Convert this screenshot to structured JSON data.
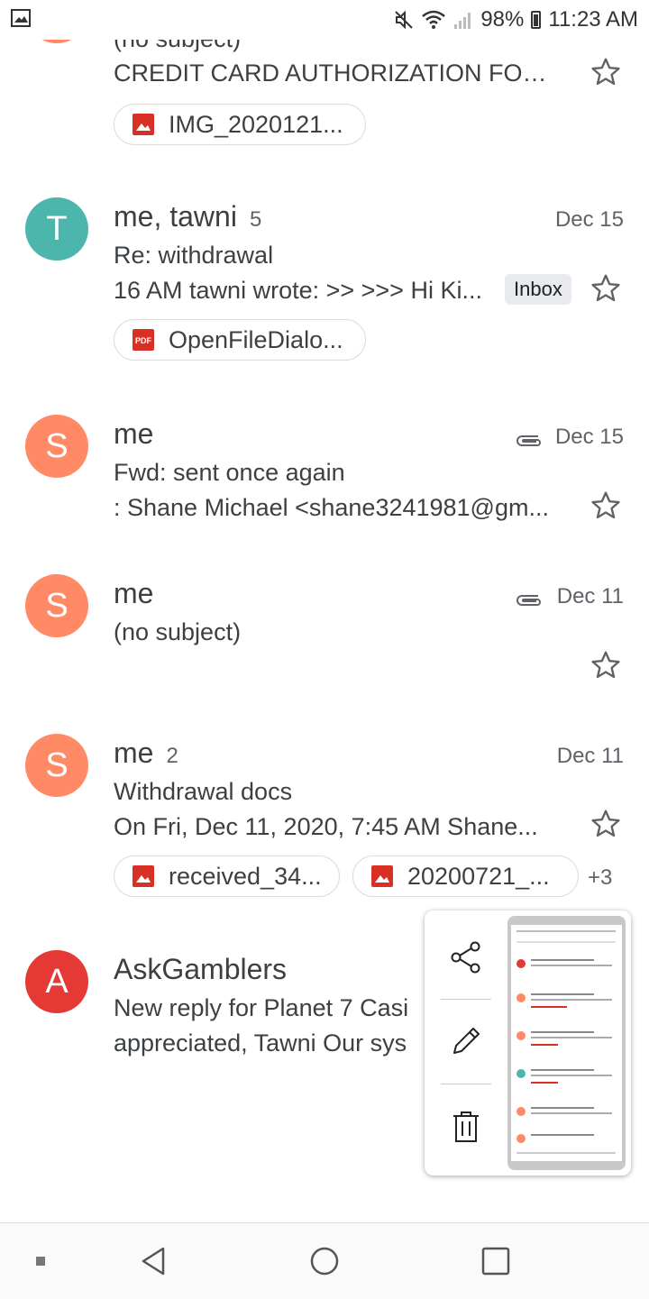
{
  "status_bar": {
    "battery": "98%",
    "time": "11:23 AM"
  },
  "emails": [
    {
      "id": "e0",
      "sender": "",
      "subject": "(no subject)",
      "snippet": "CREDIT CARD AUTHORIZATION FOR...",
      "attachments": [
        "IMG_2020121..."
      ],
      "avatar_color": "#ff8a65"
    },
    {
      "id": "e1",
      "avatar_letter": "T",
      "avatar_color": "#4db6ac",
      "sender": "me, tawni",
      "count": "5",
      "date": "Dec 15",
      "subject": "Re: withdrawal",
      "snippet": "16 AM tawni wrote: >> >>> Hi Ki...",
      "label": "Inbox",
      "attachments": [
        "OpenFileDialo..."
      ]
    },
    {
      "id": "e2",
      "avatar_letter": "S",
      "avatar_color": "#ff8a65",
      "sender": "me",
      "date": "Dec 15",
      "subject": "Fwd: sent once again",
      "snippet": ": Shane Michael <shane3241981@gm..."
    },
    {
      "id": "e3",
      "avatar_letter": "S",
      "avatar_color": "#ff8a65",
      "sender": "me",
      "date": "Dec 11",
      "subject": "(no subject)"
    },
    {
      "id": "e4",
      "avatar_letter": "S",
      "avatar_color": "#ff8a65",
      "sender": "me",
      "count": "2",
      "date": "Dec 11",
      "subject": "Withdrawal docs",
      "snippet": "On Fri, Dec 11, 2020, 7:45 AM Shane...",
      "attachments": [
        "received_34...",
        "20200721_..."
      ],
      "more_attachments": "+3"
    },
    {
      "id": "e5",
      "avatar_letter": "A",
      "avatar_color": "#e53935",
      "sender": "AskGamblers",
      "subject": "New reply for Planet 7 Casi",
      "snippet": "appreciated, Tawni Our sys"
    }
  ],
  "popup": {
    "actions": [
      "share",
      "edit",
      "delete"
    ]
  },
  "colors": {
    "accent_red": "#d93025",
    "avatar_orange": "#ff8a65",
    "avatar_teal": "#4db6ac",
    "avatar_red": "#e53935"
  }
}
